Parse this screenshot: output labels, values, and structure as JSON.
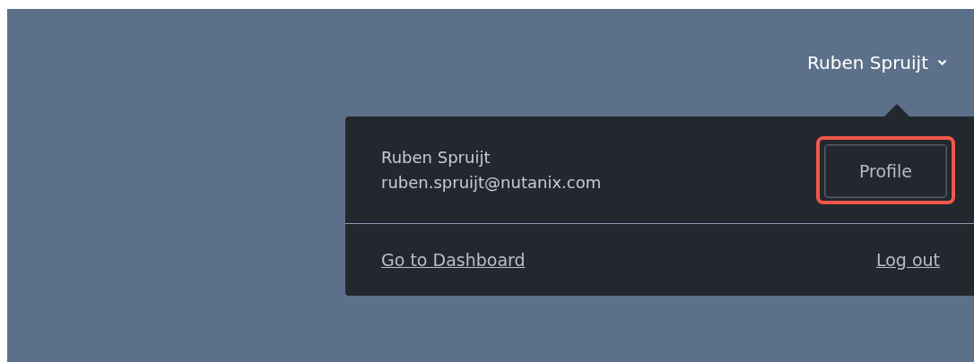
{
  "header": {
    "user_menu": {
      "label": "Ruben Spruijt",
      "expanded": true
    }
  },
  "dropdown": {
    "user_name": "Ruben Spruijt",
    "email": "ruben.spruijt@nutanix.com",
    "profile_button": {
      "label": "Profile",
      "highlighted": true
    },
    "links": [
      {
        "label": "Go to Dashboard"
      },
      {
        "label": "Log out"
      }
    ]
  }
}
